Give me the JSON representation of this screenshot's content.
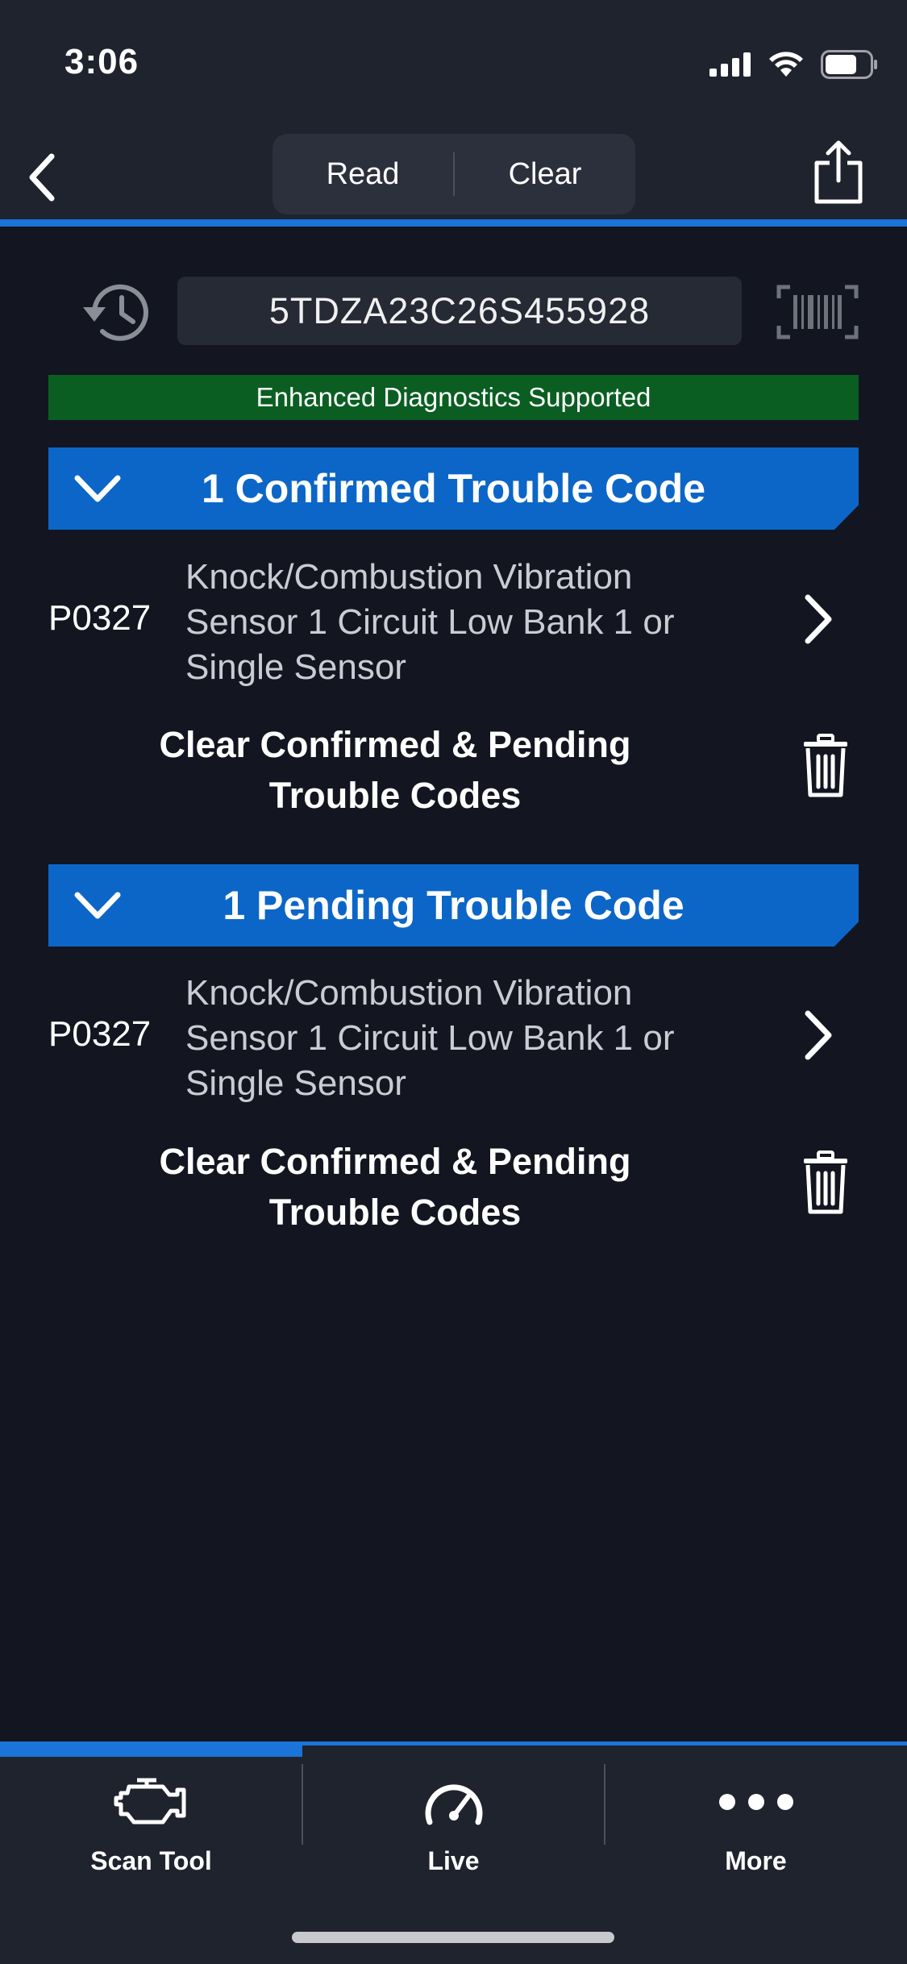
{
  "status_bar": {
    "time": "3:06"
  },
  "nav": {
    "segments": [
      {
        "label": "Read"
      },
      {
        "label": "Clear"
      }
    ]
  },
  "vin": {
    "value": "5TDZA23C26S455928"
  },
  "enhanced_banner": {
    "text": "Enhanced Diagnostics Supported",
    "color": "#0b5e22"
  },
  "sections": [
    {
      "title": "1 Confirmed Trouble Code",
      "codes": [
        {
          "code": "P0327",
          "description": "Knock/Combustion Vibration Sensor 1 Circuit Low Bank 1 or Single Sensor"
        }
      ],
      "clear_label": "Clear Confirmed & Pending Trouble Codes"
    },
    {
      "title": "1 Pending Trouble Code",
      "codes": [
        {
          "code": "P0327",
          "description": "Knock/Combustion Vibration Sensor 1 Circuit Low Bank 1 or Single Sensor"
        }
      ],
      "clear_label": "Clear Confirmed & Pending Trouble Codes"
    }
  ],
  "tabs": [
    {
      "label": "Scan Tool",
      "icon": "engine-icon",
      "active": true
    },
    {
      "label": "Live",
      "icon": "gauge-icon",
      "active": false
    },
    {
      "label": "More",
      "icon": "more-dots-icon",
      "active": false
    }
  ],
  "colors": {
    "accent": "#0c66c7",
    "background": "#131620",
    "bar": "#1f232e"
  }
}
